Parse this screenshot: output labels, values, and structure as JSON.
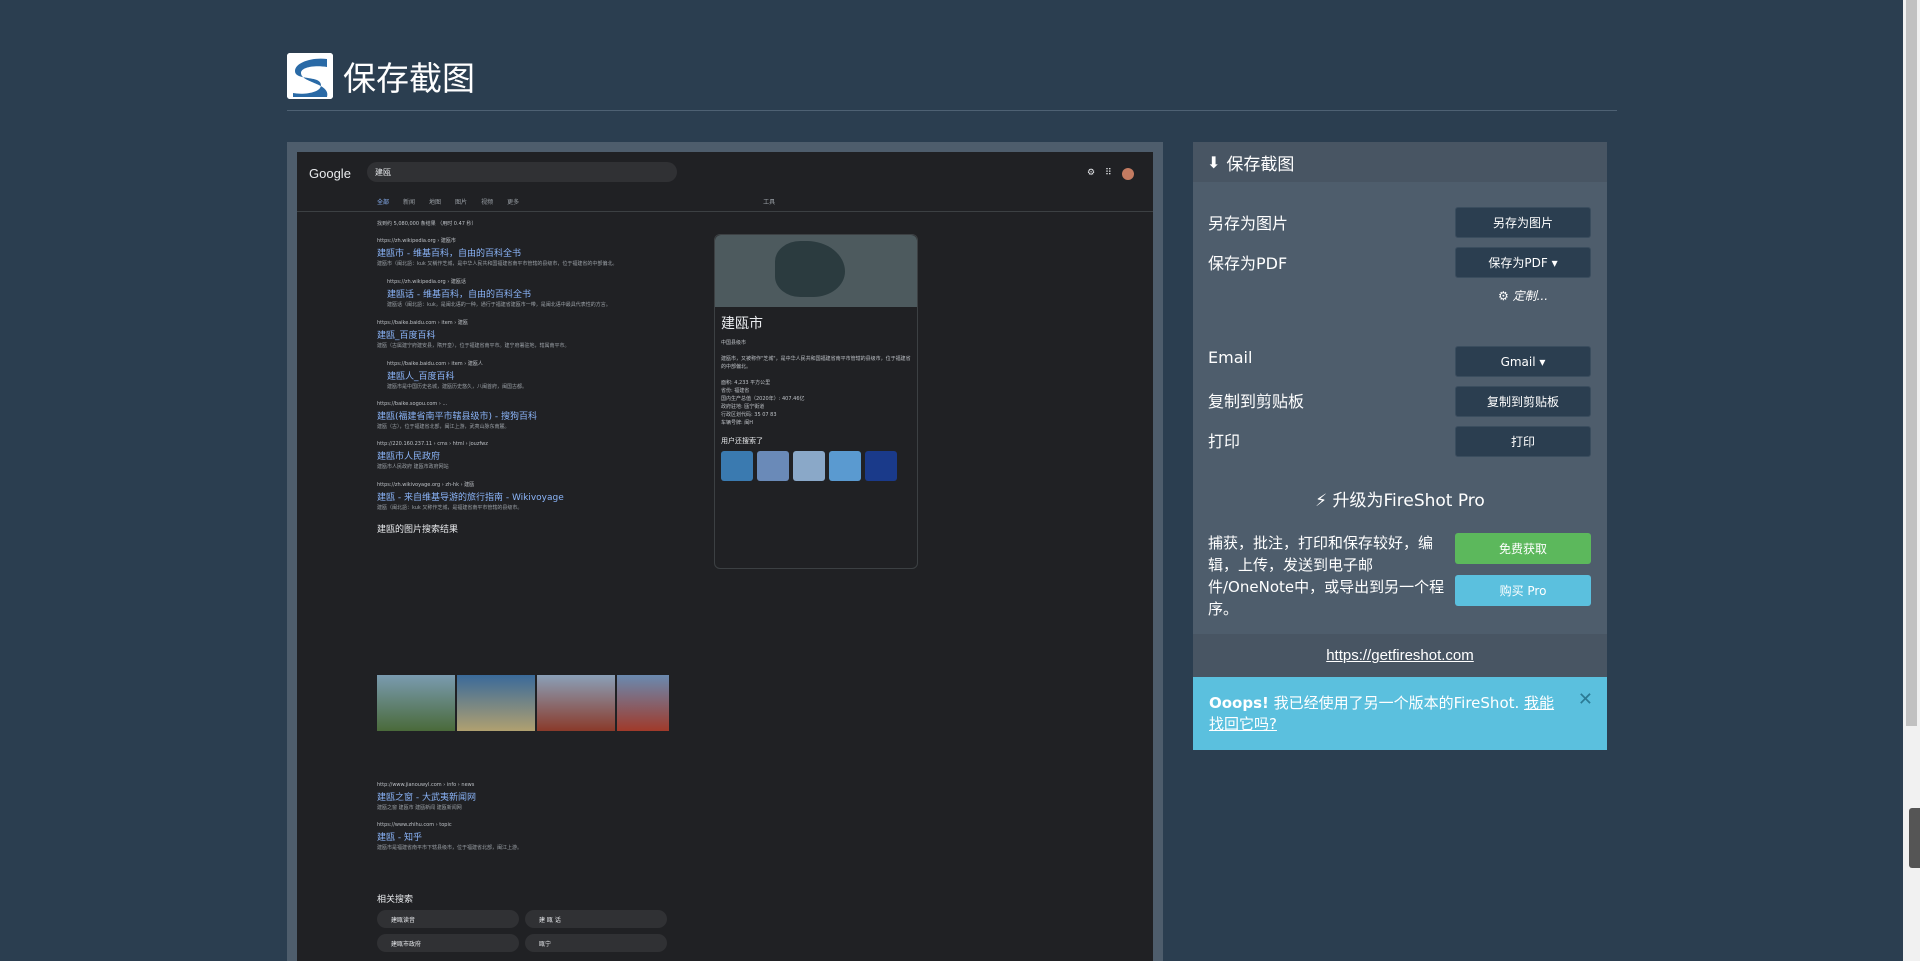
{
  "header": {
    "title": "保存截图"
  },
  "preview": {
    "search_query": "建瓯",
    "google_logo": "Google",
    "tabs": [
      "全部",
      "新闻",
      "地图",
      "图片",
      "视频",
      "更多",
      "工具"
    ],
    "stats": "找到约 5,080,000 条结果 （用时 0.47 秒）",
    "results": [
      {
        "url": "https://zh.wikipedia.org › 建瓯市",
        "title": "建瓯市 - 维基百科，自由的百科全书",
        "snippet": "建瓯市（闽北語：kuk 又稱作芝城，是中华人民共和国福建省南平市管辖的县级市，位于福建省的中部偏北。"
      },
      {
        "url": "https://zh.wikipedia.org › 建瓯话",
        "title": "建瓯话 - 维基百科，自由的百科全书",
        "snippet": "建瓯话（闽北語：kuk，是闽北语的一种，通行于福建省建瓯市一带，是闽北语中最具代表性的方言。"
      },
      {
        "url": "https://baike.baidu.com › item › 建瓯",
        "title": "建瓯_百度百科",
        "snippet": "建瓯（古属建宁府建安县，隋开皇），位于福建省南平市。建宁府署驻地，辖属南平市。"
      },
      {
        "url": "https://baike.baidu.com › item › 建瓯人",
        "title": "建瓯人_百度百科",
        "snippet": "建瓯市是中国历史名城，建瓯历史悠久，八闽首府，闽国古都。"
      },
      {
        "url": "https://baike.sogou.com › ...",
        "title": "建瓯(福建省南平市辖县级市) - 搜狗百科",
        "snippet": "建瓯（古），位于福建省北部，闽江上游，武夷山脉东南麓。"
      },
      {
        "url": "http://220.160.237.11 › cms › html › jouzfwz",
        "title": "建瓯市人民政府",
        "snippet": "建瓯市人民政府 建瓯市政府网站"
      },
      {
        "url": "https://zh.wikivoyage.org › zh-hk › 建瓯",
        "title": "建瓯 - 来自维基导游的旅行指南 - Wikivoyage",
        "snippet": "建瓯（闽北語：kuk 又称作芝城，是福建省南平市管辖的县级市。"
      }
    ],
    "images_header": "建瓯的图片搜索结果",
    "more_results": [
      {
        "url": "http://www.jianouwyl.com › info › news",
        "title": "建瓯之窗 - 大武夷新闻网",
        "snippet": "建瓯之窗 建瓯市 建瓯新闻 建瓯新闻网"
      },
      {
        "url": "https://www.zhihu.com › topic",
        "title": "建瓯 - 知乎",
        "snippet": "建瓯市是福建省南平市下辖县级市，位于福建省北部，闽江上游。"
      }
    ],
    "related_title": "相关搜索",
    "related": [
      "建瓯读音",
      "建 瓯 话",
      "建瓯市政府",
      "瓯宁"
    ],
    "kp": {
      "name": "建瓯市",
      "subtitle": "中国县级市",
      "description": "建瓯市，又被称作\"芝城\"，是中华人民共和国福建省南平市管辖的县级市，位于福建省的中部偏北。",
      "facts": [
        "面积: 4,233 平方公里",
        "省份: 福建省",
        "国内生产总值（2020年）: 407.46亿",
        "政府驻地: 瓯宁街道",
        "行政区划代码: 35 07 83",
        "车辆号牌: 闽H"
      ],
      "also_search": "用户还搜索了"
    }
  },
  "panel": {
    "title": "保存截图",
    "save_image_label": "另存为图片",
    "save_image_button": "另存为图片",
    "save_pdf_label": "保存为PDF",
    "save_pdf_button": "保存为PDF ▾",
    "customize": "定制...",
    "email_label": "Email",
    "email_button": "Gmail ▾",
    "clipboard_label": "复制到剪贴板",
    "clipboard_button": "复制到剪贴板",
    "print_label": "打印",
    "print_button": "打印",
    "upgrade_title": "升级为FireShot Pro",
    "upgrade_desc": "捕获，批注，打印和保存较好，编辑，上传，发送到电子邮件/OneNote中，或导出到另一个程序。",
    "free_button": "免费获取",
    "buy_button": "购买 Pro",
    "link": "https://getfireshot.com",
    "alert_bold": "Ooops!",
    "alert_text": " 我已经使用了另一个版本的FireShot. ",
    "alert_link": "我能找回它吗?"
  },
  "colors": {
    "background": "#2b3e50",
    "panel": "#4e5d6c",
    "success": "#5cb85c",
    "info": "#5bc0de"
  }
}
